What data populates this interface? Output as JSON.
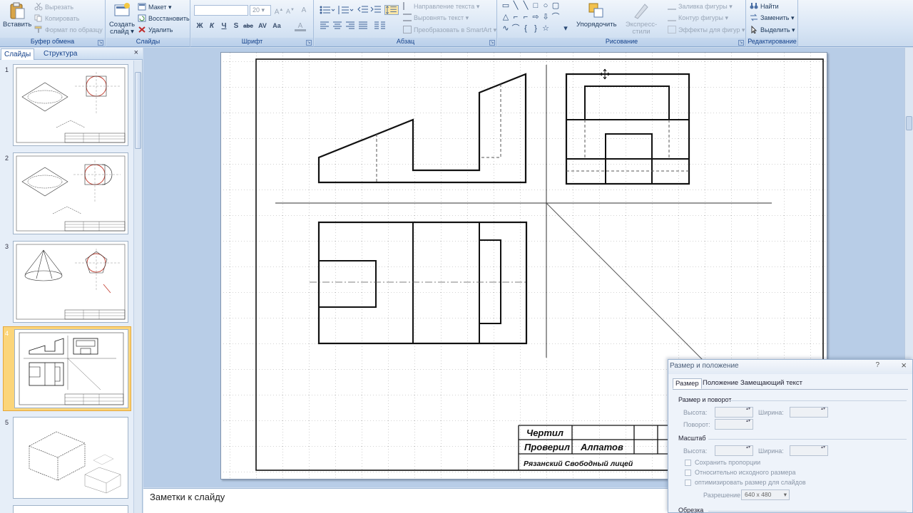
{
  "ribbon": {
    "clipboard": {
      "label": "Буфер обмена",
      "paste": "Вставить",
      "cut": "Вырезать",
      "copy": "Копировать",
      "format_painter": "Формат по образцу"
    },
    "slides": {
      "label": "Слайды",
      "new_slide_line1": "Создать",
      "new_slide_line2": "слайд",
      "layout": "Макет",
      "reset": "Восстановить",
      "delete": "Удалить"
    },
    "font": {
      "label": "Шрифт",
      "size": "20",
      "bold": "Ж",
      "italic": "К",
      "underline": "Ч",
      "shadow": "S",
      "strike": "abc",
      "spacing": "AV",
      "case": "Aa",
      "grow": "A",
      "shrink": "A",
      "clear": "A",
      "color": "A"
    },
    "paragraph": {
      "label": "Абзац",
      "text_direction": "Направление текста",
      "align_text": "Выровнять текст",
      "smartart": "Преобразовать в SmartArt"
    },
    "drawing": {
      "label": "Рисование",
      "arrange": "Упорядочить",
      "quick_styles": "Экспресс-стили",
      "shape_fill": "Заливка фигуры",
      "shape_outline": "Контур фигуры",
      "shape_effects": "Эффекты для фигур"
    },
    "editing": {
      "label": "Редактирование",
      "find": "Найти",
      "replace": "Заменить",
      "select": "Выделить"
    }
  },
  "panel": {
    "tab_slides": "Слайды",
    "tab_outline": "Структура",
    "close": "×",
    "slide_numbers": [
      "1",
      "2",
      "3",
      "4",
      "5"
    ]
  },
  "notes": {
    "placeholder": "Заметки к слайду"
  },
  "title_block": {
    "drew_label": "Чертил",
    "checked_label": "Проверил",
    "checked_name": "Алпатов",
    "school": "Рязанский Свободный лицей"
  },
  "dialog": {
    "title": "Размер и положение",
    "help": "?",
    "close": "×",
    "tabs": [
      "Размер",
      "Положение",
      "Замещающий текст"
    ],
    "size_rotate_header": "Размер и поворот",
    "height_label": "Высота:",
    "width_label": "Ширина:",
    "rotation_label": "Поворот:",
    "scale_header": "Масштаб",
    "scale_height_label": "Высота:",
    "scale_width_label": "Ширина:",
    "lock_aspect": "Сохранить пропорции",
    "relative_original": "Относительно исходного размера",
    "best_scale": "оптимизировать размер для слайдов",
    "resolution_label": "Разрешение",
    "resolution_value": "640 x 480",
    "crop_header": "Обрезка"
  },
  "colors": {
    "ribbon_text": "#15428b",
    "selection": "#fbd57a",
    "drawing_red": "#c0392b"
  }
}
